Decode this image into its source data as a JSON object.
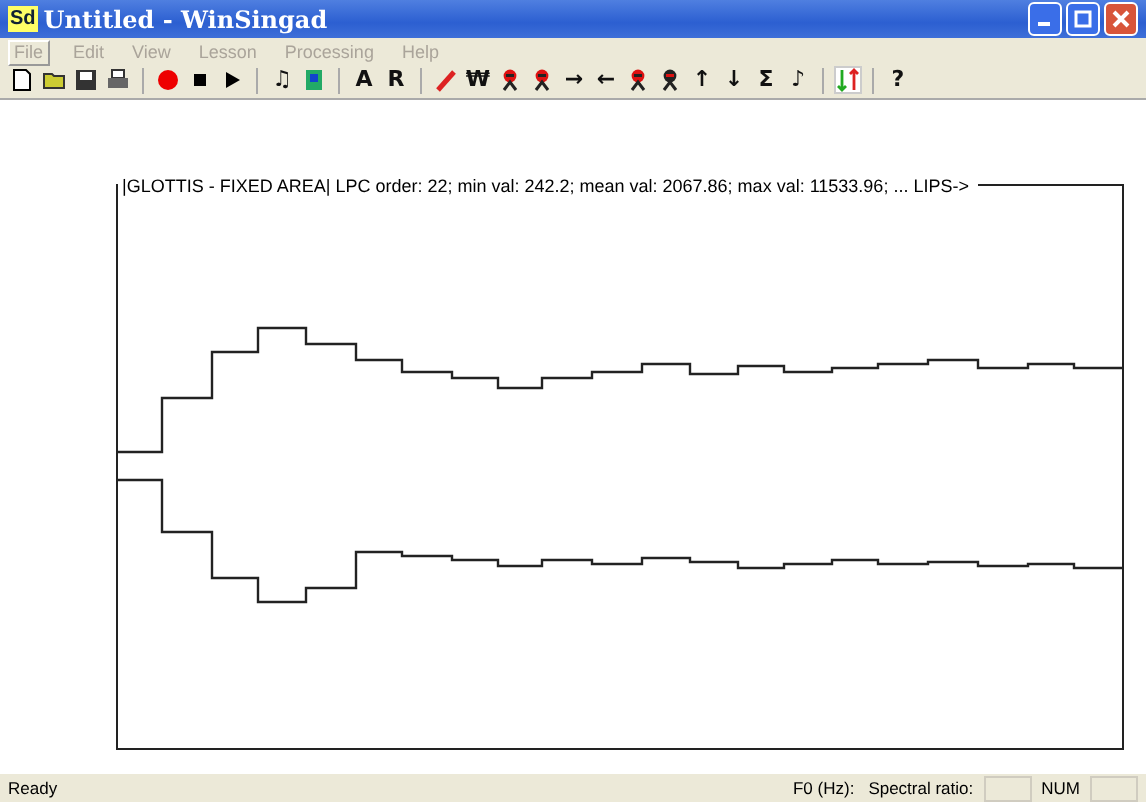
{
  "window": {
    "title": "Untitled - WinSingad",
    "icon_text": "Sd"
  },
  "menu": [
    {
      "label": "File",
      "selected": true
    },
    {
      "label": "Edit",
      "selected": false
    },
    {
      "label": "View",
      "selected": false
    },
    {
      "label": "Lesson",
      "selected": false
    },
    {
      "label": "Processing",
      "selected": false
    },
    {
      "label": "Help",
      "selected": false
    }
  ],
  "toolbar": [
    {
      "kind": "new"
    },
    {
      "kind": "open"
    },
    {
      "kind": "save"
    },
    {
      "kind": "print"
    },
    {
      "kind": "sep"
    },
    {
      "kind": "record"
    },
    {
      "kind": "stop"
    },
    {
      "kind": "play"
    },
    {
      "kind": "sep"
    },
    {
      "kind": "glyph",
      "label": "♫"
    },
    {
      "kind": "export"
    },
    {
      "kind": "sep"
    },
    {
      "kind": "glyph",
      "label": "A"
    },
    {
      "kind": "glyph",
      "label": "R"
    },
    {
      "kind": "sep"
    },
    {
      "kind": "pencil"
    },
    {
      "kind": "glyph",
      "label": "₩"
    },
    {
      "kind": "figure-red"
    },
    {
      "kind": "figure-red"
    },
    {
      "kind": "glyph",
      "label": "→"
    },
    {
      "kind": "glyph",
      "label": "←"
    },
    {
      "kind": "figure-red"
    },
    {
      "kind": "figure-dark"
    },
    {
      "kind": "glyph",
      "label": "↑"
    },
    {
      "kind": "glyph",
      "label": "↓"
    },
    {
      "kind": "glyph",
      "label": "Σ"
    },
    {
      "kind": "glyph",
      "label": "♪"
    },
    {
      "kind": "sep"
    },
    {
      "kind": "updown",
      "selected": true
    },
    {
      "kind": "sep"
    },
    {
      "kind": "glyph",
      "label": "?"
    }
  ],
  "plot": {
    "header": "|GLOTTIS - FIXED AREA|  LPC order: 22; min val: 242.2; mean val: 2067.86; max val: 11533.96; ...  LIPS->"
  },
  "status_bar": {
    "message": "Ready",
    "panes": [
      {
        "kind": "text",
        "label": "F0 (Hz):"
      },
      {
        "kind": "text",
        "label": "Spectral ratio:"
      },
      {
        "kind": "empty"
      },
      {
        "kind": "text",
        "label": "NUM"
      },
      {
        "kind": "empty"
      }
    ]
  }
}
